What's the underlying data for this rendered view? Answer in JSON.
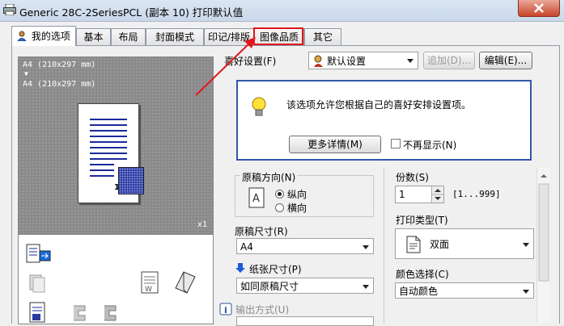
{
  "window": {
    "title": "Generic 28C-2SeriesPCL (副本 10) 打印默认值"
  },
  "tabs": [
    {
      "label": "我的选项"
    },
    {
      "label": "基本"
    },
    {
      "label": "布局"
    },
    {
      "label": "封面模式"
    },
    {
      "label": "印记/排版"
    },
    {
      "label": "图像品质"
    },
    {
      "label": "其它"
    }
  ],
  "preview": {
    "paper_line1": "A4 (210x297 mm)",
    "arrow": "▼",
    "paper_line2": "A4 (210x297 mm)",
    "page_number": "1",
    "copies_indicator": "x1"
  },
  "favorites": {
    "label": "喜好设置(F)",
    "value": "默认设置",
    "add_button": "追加(D)...",
    "edit_button": "编辑(E)..."
  },
  "info": {
    "message": "该选项允许您根据自己的喜好安排设置项。",
    "more_button": "更多详情(M)",
    "dont_show": "不再显示(N)",
    "dont_show_checked": false
  },
  "orientation": {
    "label": "原稿方向(N)",
    "portrait": "纵向",
    "landscape": "横向",
    "selected": "portrait"
  },
  "original_size": {
    "label": "原稿尺寸(R)",
    "value": "A4"
  },
  "paper_size": {
    "label": "纸张尺寸(P)",
    "value": "如同原稿尺寸"
  },
  "output_method": {
    "label": "输出方式(U)"
  },
  "copies": {
    "label": "份数(S)",
    "value": "1",
    "range": "[1...999]"
  },
  "print_type": {
    "label": "打印类型(T)",
    "value": "双面"
  },
  "color_select": {
    "label": "颜色选择(C)",
    "value": "自动颜色"
  },
  "colors": {
    "highlight_red": "#e0161c",
    "info_border": "#3355aa",
    "arrow_blue": "#1e5adc"
  }
}
